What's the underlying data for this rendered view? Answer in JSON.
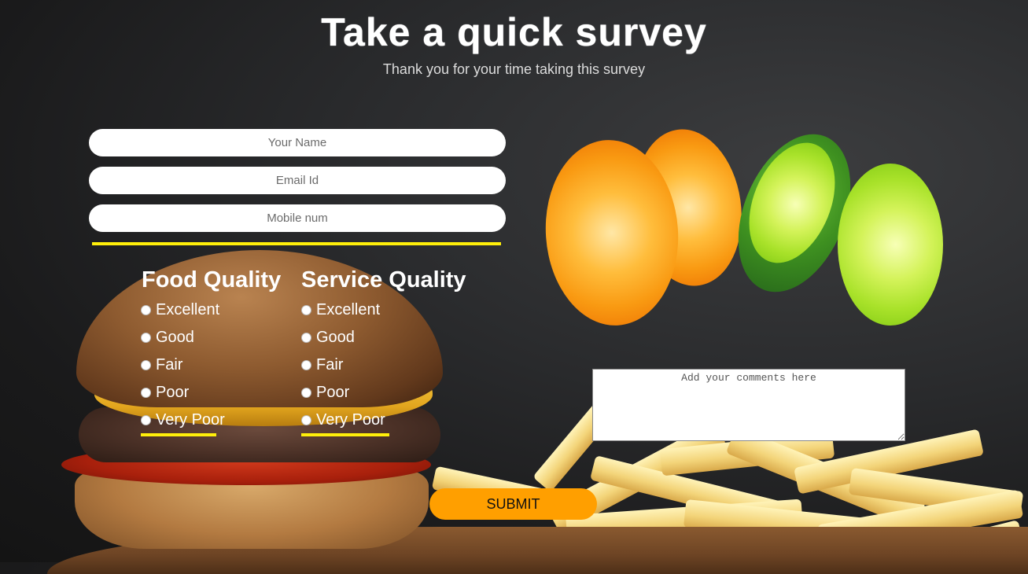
{
  "header": {
    "title": "Take a quick survey",
    "subtitle": "Thank you for your time taking this survey"
  },
  "form": {
    "name_placeholder": "Your Name",
    "email_placeholder": "Email Id",
    "mobile_placeholder": "Mobile num",
    "comments_placeholder": "Add your comments here",
    "submit_label": "SUBMIT"
  },
  "food_quality": {
    "title": "Food Quality",
    "options": [
      "Excellent",
      "Good",
      "Fair",
      "Poor",
      "Very Poor"
    ]
  },
  "service_quality": {
    "title": "Service Quality",
    "options": [
      "Excellent",
      "Good",
      "Fair",
      "Poor",
      "Very Poor"
    ]
  },
  "colors": {
    "accent_yellow": "#ffef0a",
    "submit_orange": "#ff9f00",
    "background": "#1e1e1f"
  },
  "images": {
    "left_photo": "burger-image",
    "right_top_photo": "citrus-fruit-image",
    "bottom_right_photo": "french-fries-image"
  }
}
